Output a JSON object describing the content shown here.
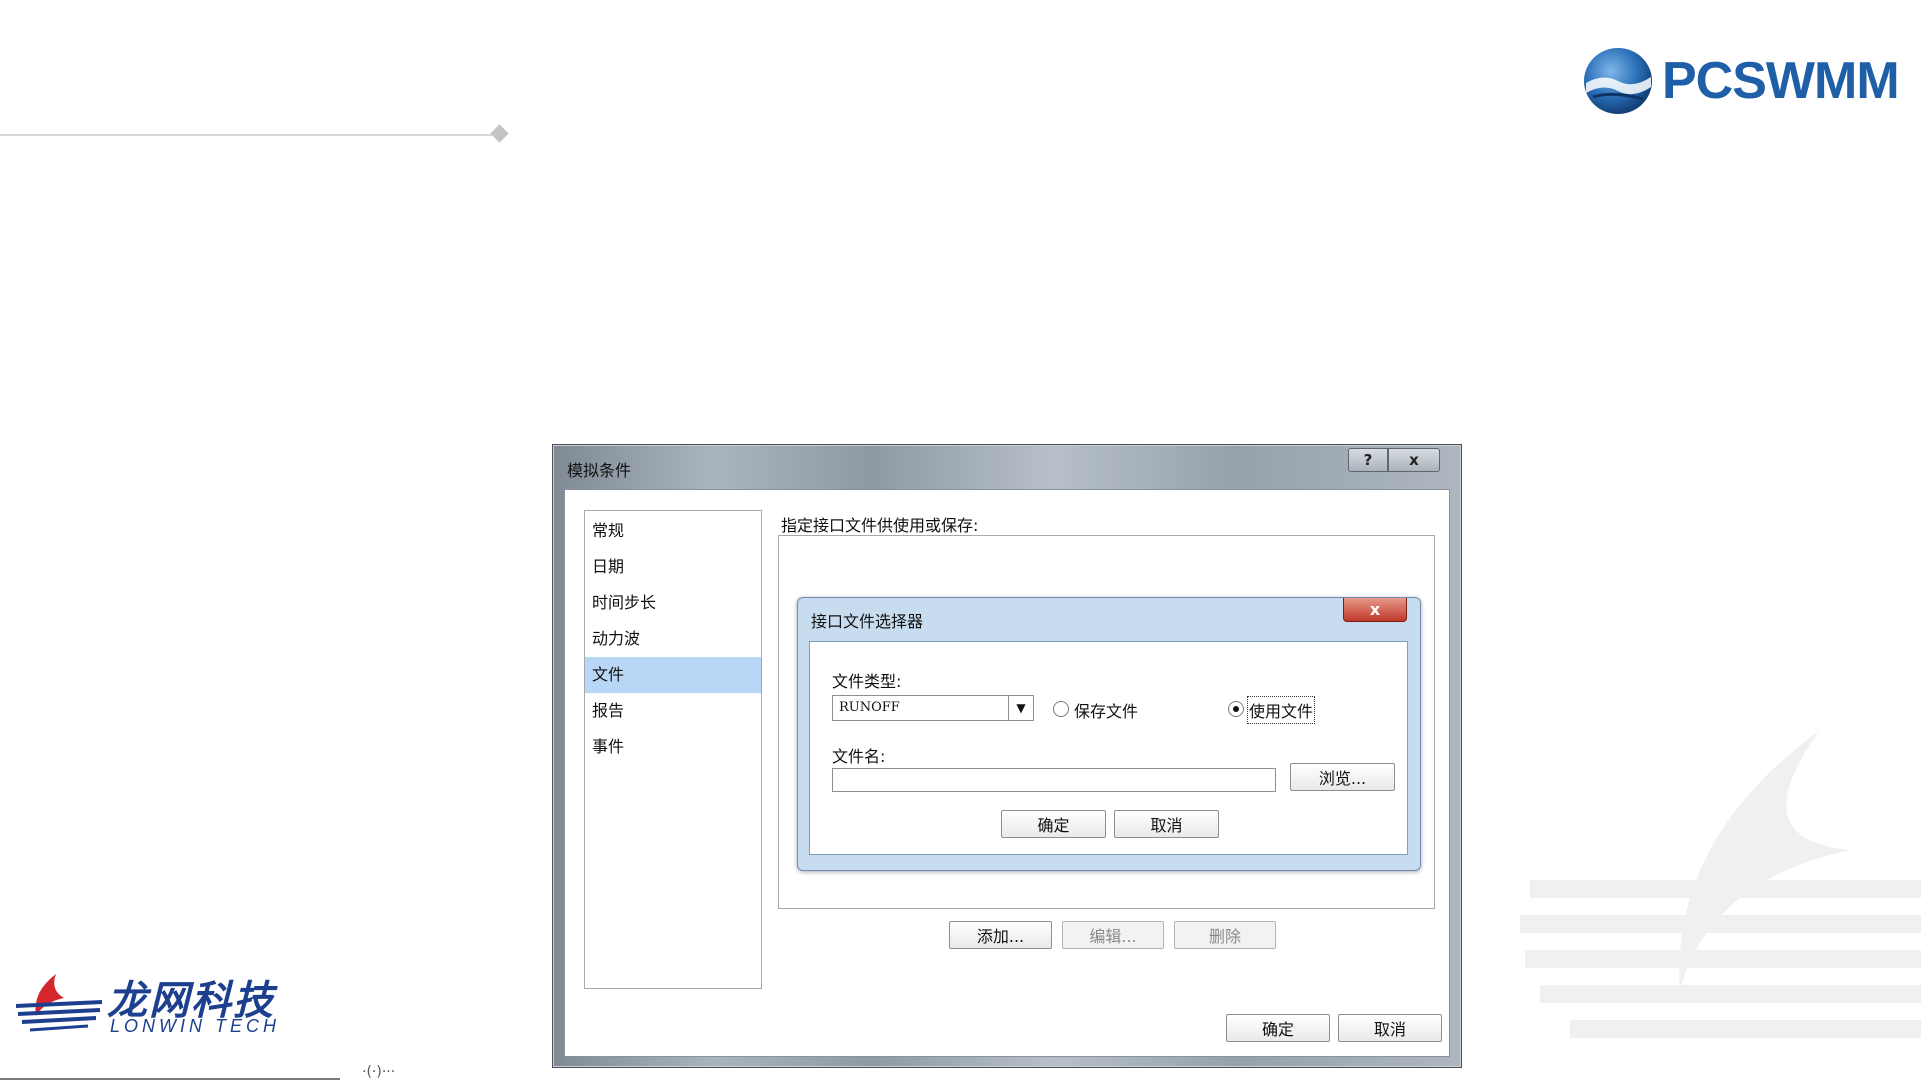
{
  "slide": {
    "bottom_fragment": "·(·)···"
  },
  "logos": {
    "pcswmm": "PCSWMM",
    "lonwin_cn": "龙网科技",
    "lonwin_en": "LONWIN TECH"
  },
  "dialog": {
    "title": "模拟条件",
    "help_label": "?",
    "close_label": "x",
    "nav_items": [
      {
        "label": "常规"
      },
      {
        "label": "日期"
      },
      {
        "label": "时间步长"
      },
      {
        "label": "动力波"
      },
      {
        "label": "文件",
        "selected": true
      },
      {
        "label": "报告"
      },
      {
        "label": "事件"
      }
    ],
    "files_heading": "指定接口文件供使用或保存:",
    "add_label": "添加...",
    "edit_label": "编辑...",
    "delete_label": "删除",
    "ok_label": "确定",
    "cancel_label": "取消"
  },
  "sub_dialog": {
    "title": "接口文件选择器",
    "close_label": "x",
    "file_type_label": "文件类型:",
    "file_type_value": "RUNOFF",
    "radio_save_label": "保存文件",
    "radio_use_label": "使用文件",
    "selected_radio": "使用文件",
    "file_name_label": "文件名:",
    "file_name_value": "",
    "browse_label": "浏览...",
    "ok_label": "确定",
    "cancel_label": "取消"
  },
  "colors": {
    "brand_blue": "#1f5fa7",
    "lonwin_blue": "#1c3f8f",
    "lonwin_red": "#d5262b",
    "selection": "#b8d6f5"
  }
}
